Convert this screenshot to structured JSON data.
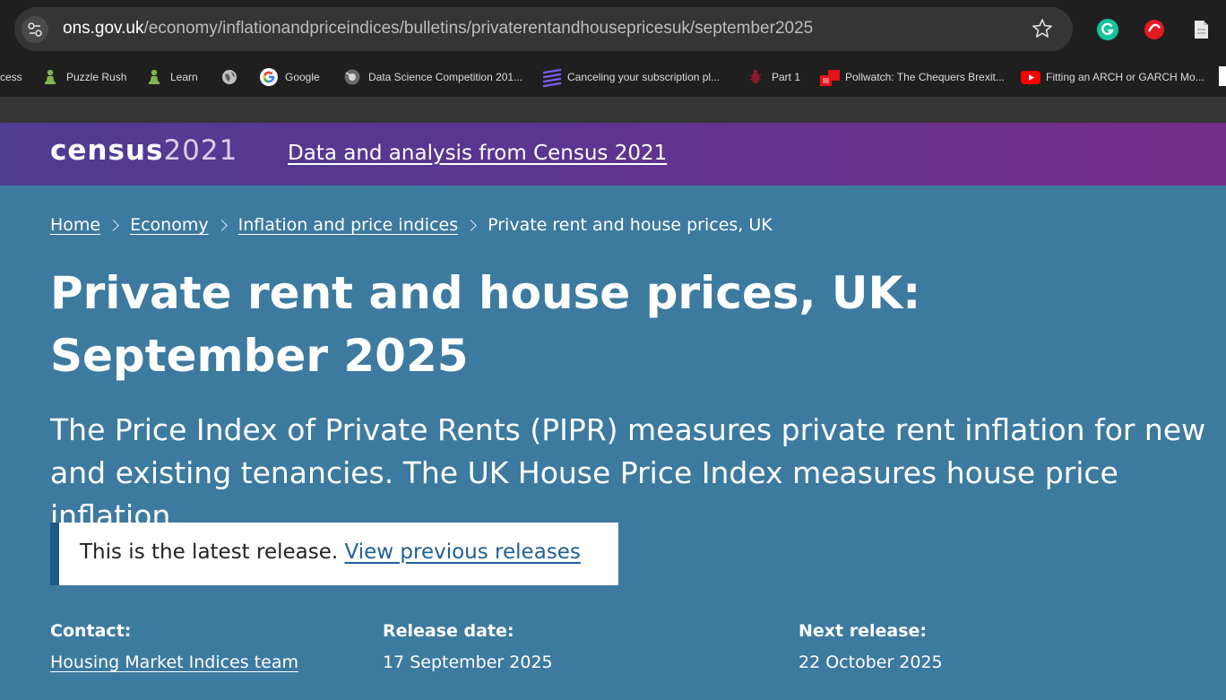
{
  "browser": {
    "url_domain": "ons.gov.uk",
    "url_path": "/economy/inflationandpriceindices/bulletins/privaterentandhousepricesuk/september2025",
    "icons": [
      "tune-icon",
      "star-icon",
      "grammarly-icon",
      "extension-icon",
      "document-icon"
    ]
  },
  "bookmarks": [
    {
      "label": "cess",
      "icon": "globe-icon"
    },
    {
      "label": "Puzzle Rush",
      "icon": "chess-pawn-icon"
    },
    {
      "label": "Learn",
      "icon": "chess-pawn-icon"
    },
    {
      "label": "",
      "icon": "globe-icon"
    },
    {
      "label": "Google",
      "icon": "google-icon"
    },
    {
      "label": "Data Science Competition 201...",
      "icon": "kaggle-icon"
    },
    {
      "label": "Canceling your subscription pl...",
      "icon": "stripes-icon"
    },
    {
      "label": "Part 1",
      "icon": "bug-icon"
    },
    {
      "label": "Pollwatch: The Chequers Brexit...",
      "icon": "red-square-icon"
    },
    {
      "label": "Fitting an ARCH or GARCH Mo...",
      "icon": "youtube-icon"
    }
  ],
  "banner": {
    "logo_word": "census",
    "logo_year": "2021",
    "link": "Data and analysis from Census 2021"
  },
  "breadcrumb": [
    "Home",
    "Economy",
    "Inflation and price indices",
    "Private rent and house prices, UK"
  ],
  "title": "Private rent and house prices, UK: September 2025",
  "lede": "The Price Index of Private Rents (PIPR) measures private rent inflation for new and existing tenancies. The UK House Price Index measures house price inflation.",
  "release_notice": {
    "text": "This is the latest release.",
    "link": "View previous releases"
  },
  "meta": {
    "contact_label": "Contact:",
    "contact_value": "Housing Market Indices team",
    "release_label": "Release date:",
    "release_value": "17 September 2025",
    "next_label": "Next release:",
    "next_value": "22 October 2025"
  },
  "colors": {
    "page_background": "#3d7a9f",
    "banner_start": "#4f3c93",
    "banner_end": "#762e8a",
    "notice_border": "#1d5a88",
    "link": "#206095"
  }
}
